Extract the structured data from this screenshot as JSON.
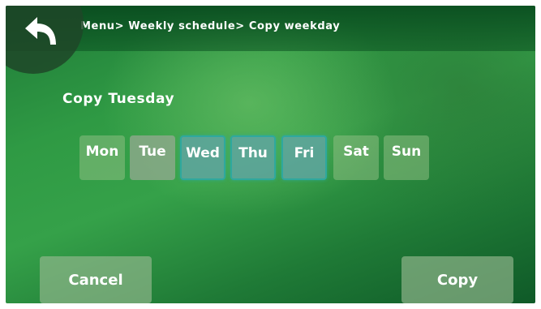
{
  "header": {
    "breadcrumb": "Menu> Weekly schedule> Copy weekday",
    "back_icon": "back-arrow-icon"
  },
  "main": {
    "title": "Copy Tuesday",
    "days": [
      {
        "label": "Mon",
        "state": "unselected"
      },
      {
        "label": "Tue",
        "state": "source"
      },
      {
        "label": "Wed",
        "state": "selected"
      },
      {
        "label": "Thu",
        "state": "selected"
      },
      {
        "label": "Fri",
        "state": "selected"
      },
      {
        "label": "Sat",
        "state": "unselected"
      },
      {
        "label": "Sun",
        "state": "unselected"
      }
    ]
  },
  "footer": {
    "cancel_label": "Cancel",
    "copy_label": "Copy"
  },
  "colors": {
    "background": "#2f9a44",
    "selected_border": "#2fa89e"
  }
}
